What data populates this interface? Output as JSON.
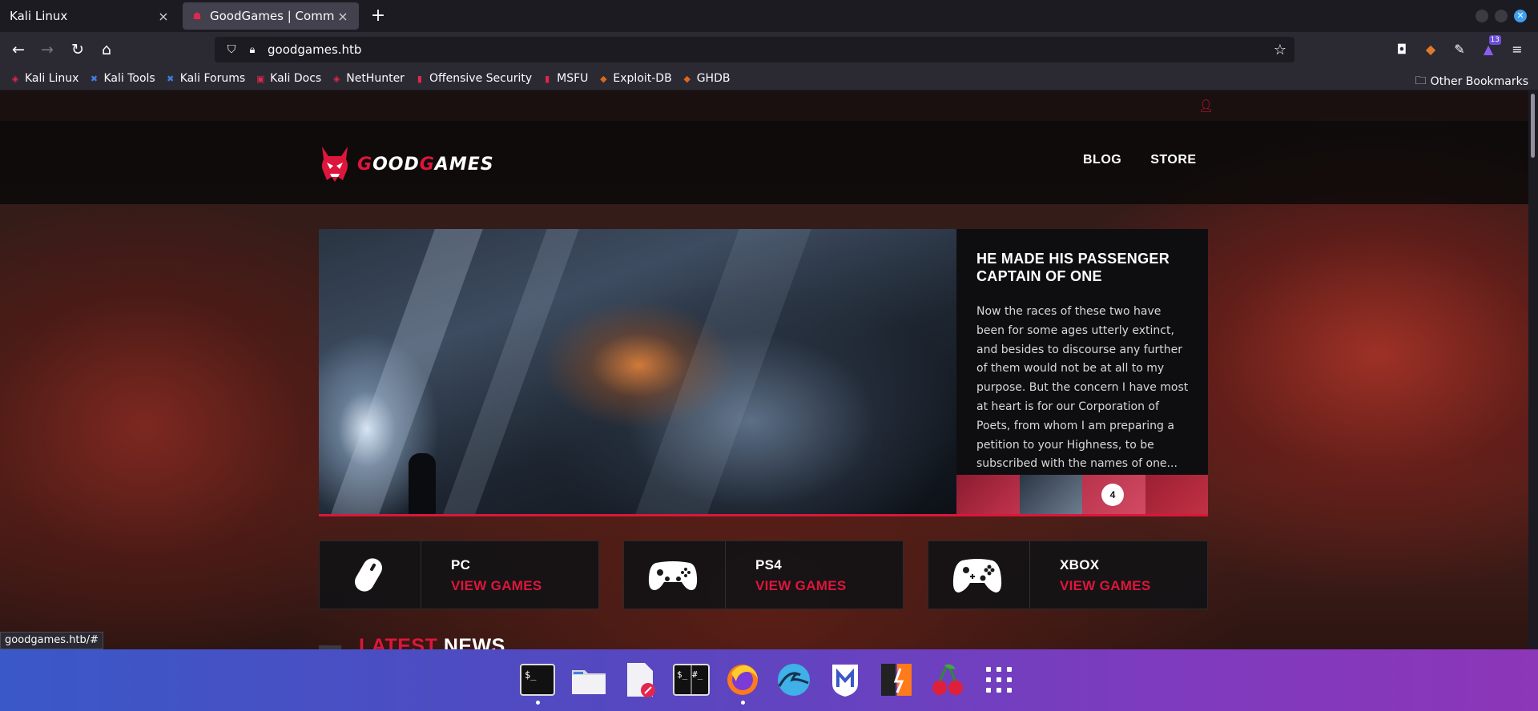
{
  "browser": {
    "tabs": [
      {
        "label": "Kali Linux",
        "close": "×"
      },
      {
        "label": "GoodGames | Community",
        "close": "×"
      }
    ],
    "new_tab": "+",
    "url": "goodgames.htb",
    "extension_badge": "13",
    "bookmarks": [
      {
        "label": "Kali Linux",
        "icon": "kali-icon",
        "color": "#e2264d"
      },
      {
        "label": "Kali Tools",
        "icon": "kali-tools-icon",
        "color": "#3f7fe0"
      },
      {
        "label": "Kali Forums",
        "icon": "kali-forums-icon",
        "color": "#3f7fe0"
      },
      {
        "label": "Kali Docs",
        "icon": "kali-docs-icon",
        "color": "#e2264d"
      },
      {
        "label": "NetHunter",
        "icon": "nethunter-icon",
        "color": "#e2264d"
      },
      {
        "label": "Offensive Security",
        "icon": "offsec-icon",
        "color": "#e2264d"
      },
      {
        "label": "MSFU",
        "icon": "msfu-icon",
        "color": "#e2264d"
      },
      {
        "label": "Exploit-DB",
        "icon": "exploit-db-icon",
        "color": "#e0671e"
      },
      {
        "label": "GHDB",
        "icon": "ghdb-icon",
        "color": "#e0671e"
      }
    ],
    "other_bookmarks": "Other Bookmarks",
    "status_url": "goodgames.htb/#"
  },
  "site": {
    "logo": {
      "part1": "G",
      "part2": "OOD",
      "part3": "G",
      "part4": "AMES"
    },
    "nav": [
      "BLOG",
      "STORE"
    ],
    "slider": {
      "title": "HE MADE HIS PASSENGER CAPTAIN OF ONE",
      "text": "Now the races of these two have been for some ages utterly extinct, and besides to discourse any further of them would not be at all to my purpose. But the concern I have most at heart is for our Corporation of Poets, from whom I am preparing a petition to your Highness, to be subscribed with the names of one...",
      "current_thumb": "4"
    },
    "categories": [
      {
        "title": "PC",
        "link": "VIEW GAMES",
        "icon": "mouse-icon"
      },
      {
        "title": "PS4",
        "link": "VIEW GAMES",
        "icon": "ps4-gamepad-icon"
      },
      {
        "title": "XBOX",
        "link": "VIEW GAMES",
        "icon": "xbox-gamepad-icon"
      }
    ],
    "latest": {
      "part1": "LATEST",
      "part2": "NEWS"
    },
    "accent_color": "#dd163b"
  },
  "dock": {
    "apps": [
      "terminal",
      "files",
      "text-editor",
      "root-terminal",
      "firefox",
      "wireshark",
      "metasploit",
      "burpsuite",
      "cherrytree",
      "app-grid"
    ]
  }
}
